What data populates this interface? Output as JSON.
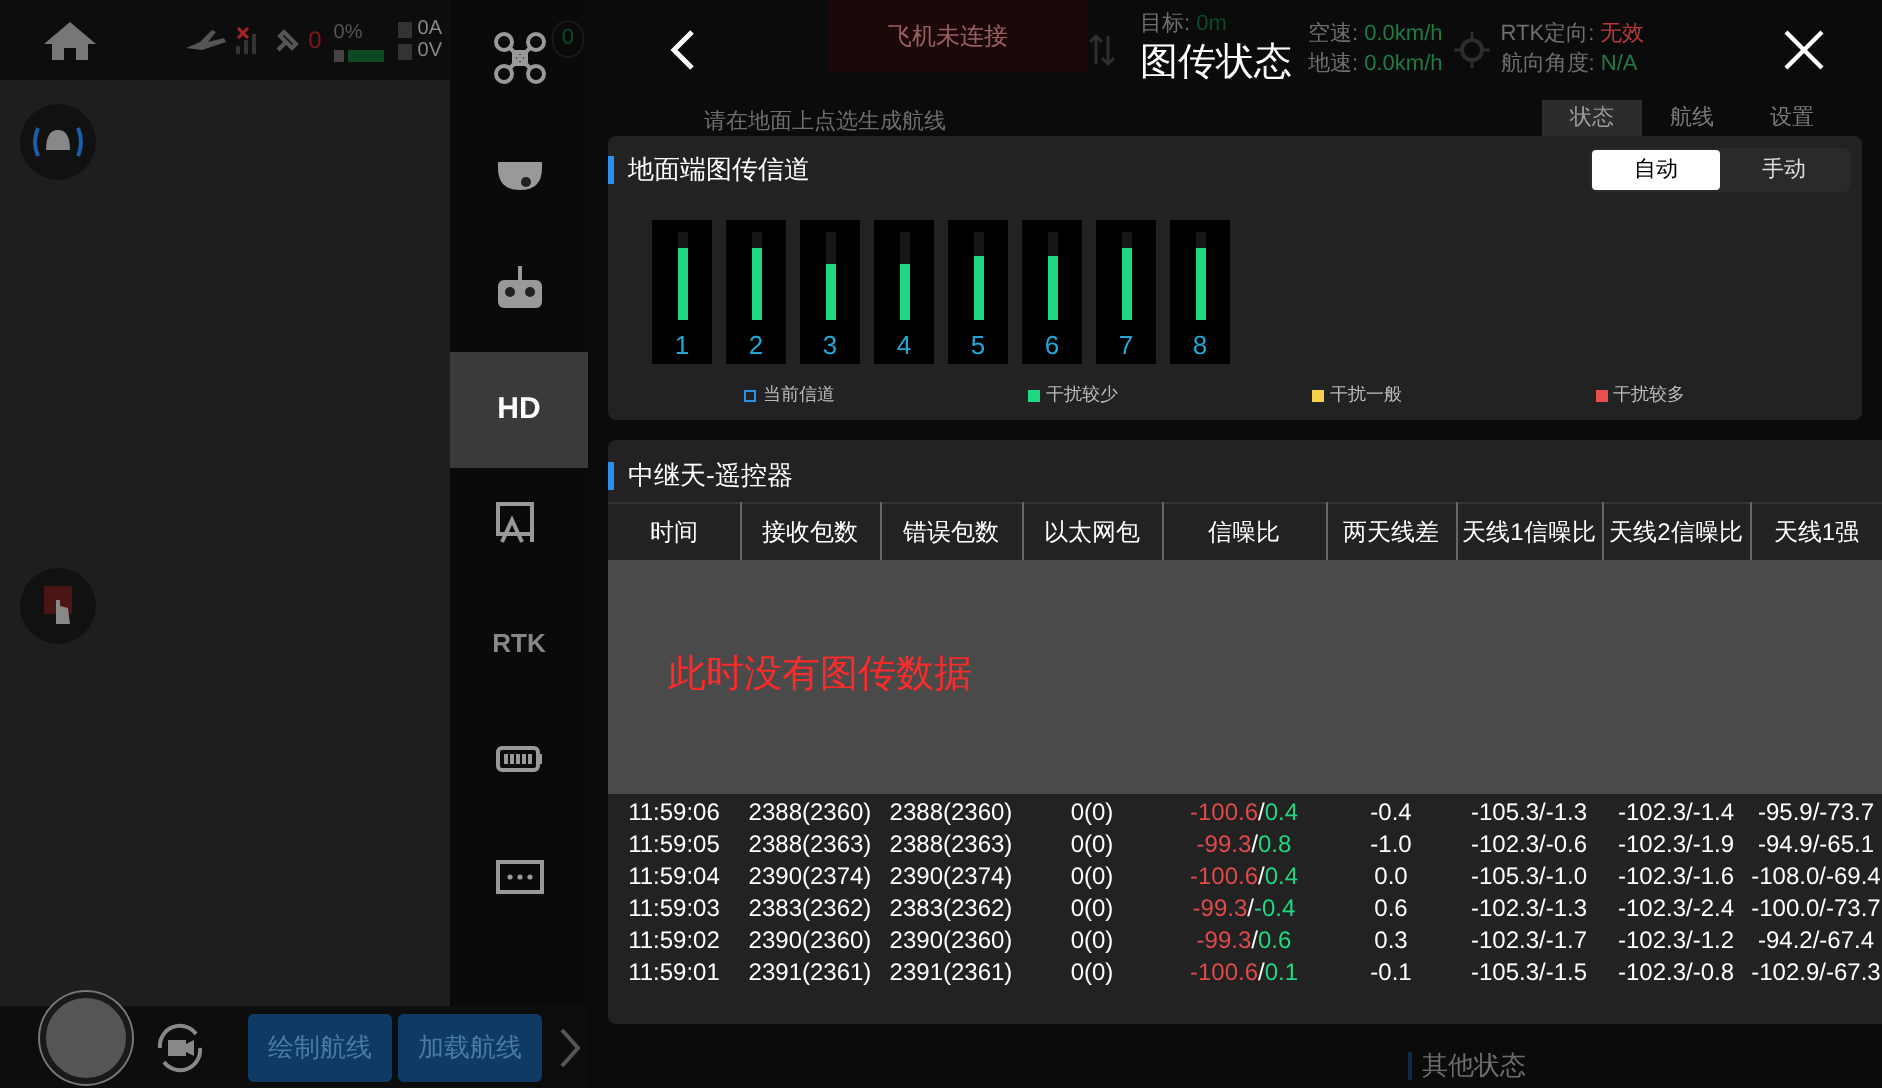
{
  "status_bar": {
    "satellites": "0",
    "battery_percent": "0%",
    "current": "0A",
    "voltage": "0V",
    "link_count": "0"
  },
  "sidebar": {
    "items": [
      {
        "kind": "drone",
        "selected": false
      },
      {
        "kind": "gimbal",
        "selected": false
      },
      {
        "kind": "controller",
        "selected": false
      },
      {
        "kind": "text",
        "label": "HD",
        "selected": true
      },
      {
        "kind": "ai",
        "selected": false
      },
      {
        "kind": "text",
        "label": "RTK",
        "selected": false
      },
      {
        "kind": "battery",
        "selected": false
      },
      {
        "kind": "more",
        "selected": false
      }
    ]
  },
  "bottom_bar": {
    "buttons": [
      "绘制航线",
      "加载航线"
    ]
  },
  "background": {
    "flight_status": "飞机未连接",
    "target": {
      "label": "目标:",
      "value": "0m"
    },
    "readouts": [
      {
        "label": "空速:",
        "value": "0.0km/h",
        "color": "#1f7a45"
      },
      {
        "label": "地速:",
        "value": "0.0km/h",
        "color": "#1f7a45"
      },
      {
        "label": "RTK定向:",
        "value": "无效",
        "color": "#b83a3a"
      },
      {
        "label": "航向角度:",
        "value": "N/A",
        "color": "#1f7a45"
      }
    ],
    "hint": "请在地面上点选生成航线",
    "tabs": [
      {
        "label": "状态",
        "selected": true
      },
      {
        "label": "航线",
        "selected": false
      },
      {
        "label": "设置",
        "selected": false
      }
    ],
    "section": "其他状态"
  },
  "dialog": {
    "title": "图传状态",
    "channel_panel": {
      "title": "地面端图传信道",
      "modes": [
        {
          "label": "自动",
          "selected": true
        },
        {
          "label": "手动",
          "selected": false
        }
      ],
      "channels": [
        {
          "label": "1",
          "level": 0.82,
          "color": "#1ed882"
        },
        {
          "label": "2",
          "level": 0.82,
          "color": "#1ed882"
        },
        {
          "label": "3",
          "level": 0.64,
          "color": "#1ed882"
        },
        {
          "label": "4",
          "level": 0.64,
          "color": "#1ed882"
        },
        {
          "label": "5",
          "level": 0.73,
          "color": "#1ed882"
        },
        {
          "label": "6",
          "level": 0.73,
          "color": "#1ed882"
        },
        {
          "label": "7",
          "level": 0.82,
          "color": "#1ed882"
        },
        {
          "label": "8",
          "level": 0.82,
          "color": "#1ed882"
        }
      ],
      "legend": [
        {
          "kind": "outline",
          "label": "当前信道",
          "color": "#2b8ff0"
        },
        {
          "kind": "fill",
          "label": "干扰较少",
          "color": "#1ed882"
        },
        {
          "kind": "fill",
          "label": "干扰一般",
          "color": "#f5d04a"
        },
        {
          "kind": "fill",
          "label": "干扰较多",
          "color": "#e85050"
        }
      ]
    },
    "relay_panel": {
      "title": "中继天-遥控器",
      "columns": [
        "时间",
        "接收包数",
        "错误包数",
        "以太网包",
        "信噪比",
        "两天线差",
        "天线1信噪比",
        "天线2信噪比",
        "天线1强"
      ],
      "empty_message": "此时没有图传数据",
      "rows": [
        {
          "time": "11:59:06",
          "received": "2388(2360)",
          "errors": "2388(2360)",
          "ethernet": "0(0)",
          "snr": [
            {
              "text": "-100.6",
              "color": "#e04a4a"
            },
            {
              "text": "/",
              "color": "#ffffff"
            },
            {
              "text": "0.4",
              "color": "#1ed882"
            }
          ],
          "antenna_diff": "-0.4",
          "ant1_snr": "-105.3/-1.3",
          "ant2_snr": "-102.3/-1.4",
          "ant1_strength": "-95.9/-73.7"
        },
        {
          "time": "11:59:05",
          "received": "2388(2363)",
          "errors": "2388(2363)",
          "ethernet": "0(0)",
          "snr": [
            {
              "text": "-99.3",
              "color": "#e04a4a"
            },
            {
              "text": "/",
              "color": "#ffffff"
            },
            {
              "text": "0.8",
              "color": "#1ed882"
            }
          ],
          "antenna_diff": "-1.0",
          "ant1_snr": "-102.3/-0.6",
          "ant2_snr": "-102.3/-1.9",
          "ant1_strength": "-94.9/-65.1"
        },
        {
          "time": "11:59:04",
          "received": "2390(2374)",
          "errors": "2390(2374)",
          "ethernet": "0(0)",
          "snr": [
            {
              "text": "-100.6",
              "color": "#e04a4a"
            },
            {
              "text": "/",
              "color": "#ffffff"
            },
            {
              "text": "0.4",
              "color": "#1ed882"
            }
          ],
          "antenna_diff": "0.0",
          "ant1_snr": "-105.3/-1.0",
          "ant2_snr": "-102.3/-1.6",
          "ant1_strength": "-108.0/-69.4"
        },
        {
          "time": "11:59:03",
          "received": "2383(2362)",
          "errors": "2383(2362)",
          "ethernet": "0(0)",
          "snr": [
            {
              "text": "-99.3",
              "color": "#e04a4a"
            },
            {
              "text": "/",
              "color": "#ffffff"
            },
            {
              "text": "-0.4",
              "color": "#1ed882"
            }
          ],
          "antenna_diff": "0.6",
          "ant1_snr": "-102.3/-1.3",
          "ant2_snr": "-102.3/-2.4",
          "ant1_strength": "-100.0/-73.7"
        },
        {
          "time": "11:59:02",
          "received": "2390(2360)",
          "errors": "2390(2360)",
          "ethernet": "0(0)",
          "snr": [
            {
              "text": "-99.3",
              "color": "#e04a4a"
            },
            {
              "text": "/",
              "color": "#ffffff"
            },
            {
              "text": "0.6",
              "color": "#1ed882"
            }
          ],
          "antenna_diff": "0.3",
          "ant1_snr": "-102.3/-1.7",
          "ant2_snr": "-102.3/-1.2",
          "ant1_strength": "-94.2/-67.4"
        },
        {
          "time": "11:59:01",
          "received": "2391(2361)",
          "errors": "2391(2361)",
          "ethernet": "0(0)",
          "snr": [
            {
              "text": "-100.6",
              "color": "#e04a4a"
            },
            {
              "text": "/",
              "color": "#ffffff"
            },
            {
              "text": "0.1",
              "color": "#1ed882"
            }
          ],
          "antenna_diff": "-0.1",
          "ant1_snr": "-105.3/-1.5",
          "ant2_snr": "-102.3/-0.8",
          "ant1_strength": "-102.9/-67.3"
        }
      ]
    }
  }
}
